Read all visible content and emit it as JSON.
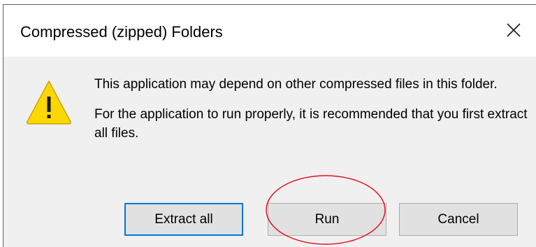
{
  "dialog": {
    "title": "Compressed (zipped) Folders",
    "close_icon": "close-icon",
    "warning_icon": "warning-icon",
    "message_line1": "This application may depend on other compressed files in this folder.",
    "message_line2": "For the application to run properly, it is recommended that you first extract all files."
  },
  "buttons": {
    "extract_all": "Extract all",
    "run": "Run",
    "cancel": "Cancel"
  },
  "colors": {
    "focus_border": "#0078d7",
    "warning_fill": "#ffd700",
    "annotation": "#e0141e"
  }
}
